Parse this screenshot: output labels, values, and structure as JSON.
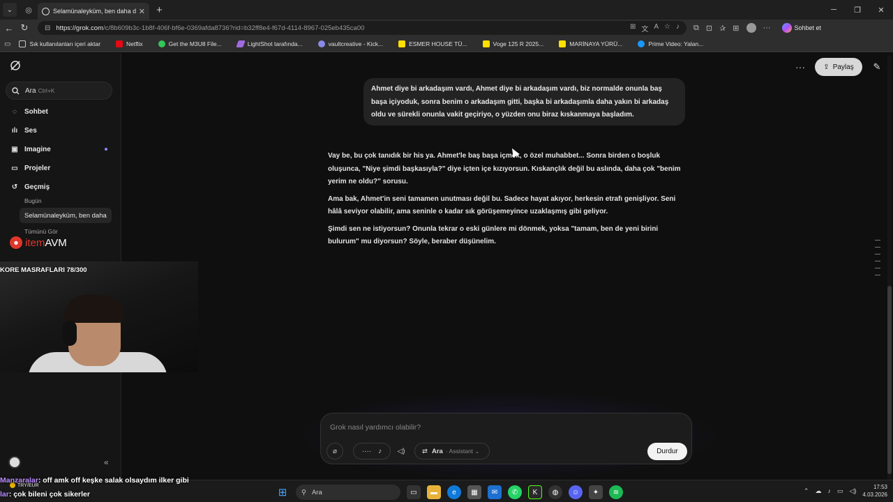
{
  "browser": {
    "tab_title": "Selamünaleyküm, ben daha d",
    "url_host": "https://grok.com",
    "url_path": "/c/8b609b3c-1b8f-406f-bf6e-0369afda8736?rid=b32ff8e4-f67d-4114-8967-025eb435ca00",
    "copilot_label": "Sohbet et",
    "bookmarks": [
      "Sık kullanılanları içeri aktar",
      "Netflix",
      "Get the M3U8 File...",
      "LightShot tarafında...",
      "vaultcreative - Kick...",
      "ESMER HOUSE TÜ...",
      "Voge 125 R 2025...",
      "MARİNAYA YÜRÜ...",
      "Prime Video: Yalan..."
    ]
  },
  "sidebar": {
    "search_label": "Ara",
    "search_shortcut": "Ctrl+K",
    "nav": {
      "chat": "Sohbet",
      "voice": "Ses",
      "imagine": "Imagine",
      "projects": "Projeler",
      "history": "Geçmiş"
    },
    "today": "Bugün",
    "recent_chat": "Selamünaleyküm, ben daha",
    "see_all": "Tümünü Gör"
  },
  "header": {
    "share_label": "Paylaş"
  },
  "conversation": {
    "user_message": "Ahmet diye bi arkadaşım vardı, Ahmet diye bi arkadaşım vardı, biz normalde onunla baş başa içiyoduk, sonra benim o arkadaşım gitti, başka bi arkadaşımla daha yakın bi arkadaş oldu ve sürekli onunla vakit geçiriyo, o yüzden onu biraz kıskanmaya başladım.",
    "answer_paragraphs": [
      "Vay be, bu çok tanıdık bir his ya. Ahmet'le baş başa içmek, o özel muhabbet... Sonra birden o boşluk oluşunca, \"Niye şimdi başkasıyla?\" diye içten içe kızıyorsun. Kıskançlık değil bu aslında, daha çok \"benim yerim ne oldu?\" sorusu.",
      "Ama bak, Ahmet'in seni tamamen unutması değil bu. Sadece hayat akıyor, herkesin etrafı genişliyor. Seni hâlâ seviyor olabilir, ama seninle o kadar sık görüşemeyince uzaklaşmış gibi geliyor.",
      "Şimdi sen ne istiyorsun? Onunla tekrar o eski günlere mi dönmek, yoksa \"tamam, ben de yeni birini bulurum\" mu diyorsun? Söyle, beraber düşünelim."
    ]
  },
  "composer": {
    "placeholder": "Grok nasıl yardımcı olabilir?",
    "model_label": "Ara",
    "model_mode": "Assistant",
    "stop_label": "Durdur"
  },
  "overlay": {
    "brand_item": "item",
    "brand_avm": "AVM",
    "goal_text": "KORE MASRAFLARI 78/300",
    "chat_nick": "Manzaralar",
    "chat_line1": ": off amk off keşke salak olsaydım ilker gibi",
    "chat_nick2": "lar",
    "chat_line2": ": çok bileni çok sikerler",
    "fx_label": "TRY/EUR"
  },
  "taskbar": {
    "search_label": "Ara",
    "time": "17:53",
    "date": "4.03.2026"
  }
}
